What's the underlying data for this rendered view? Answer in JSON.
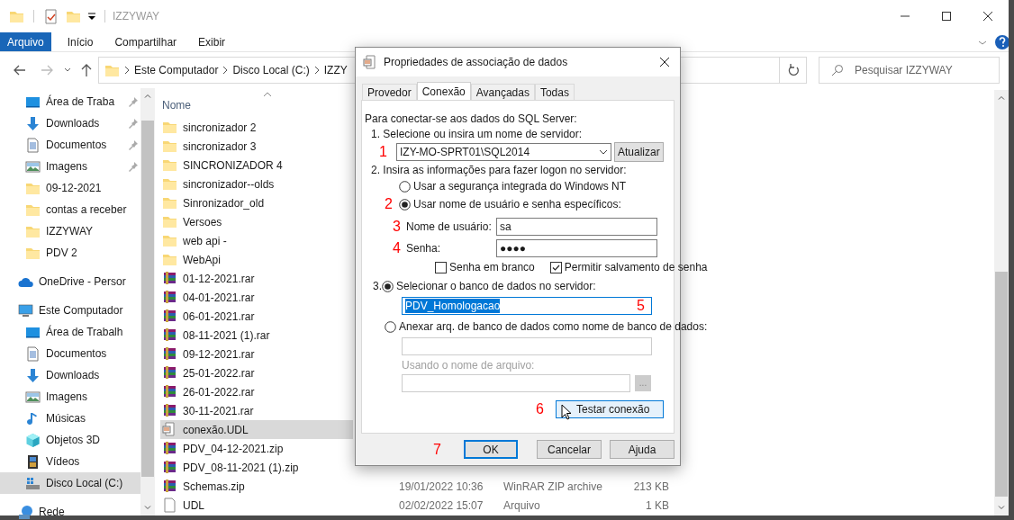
{
  "window": {
    "title": "IZZYWAY"
  },
  "ribbon_tabs": [
    {
      "label": "Arquivo",
      "selected": true
    },
    {
      "label": "Início",
      "selected": false
    },
    {
      "label": "Compartilhar",
      "selected": false
    },
    {
      "label": "Exibir",
      "selected": false
    }
  ],
  "address": {
    "breadcrumbs": [
      "Este Computador",
      "Disco Local (C:)",
      "IZZY"
    ]
  },
  "search": {
    "placeholder": "Pesquisar IZZYWAY"
  },
  "sidebar": {
    "quick_access": [
      {
        "label": "Área de Traba",
        "kind": "desktop",
        "pinned": true,
        "selected": false
      },
      {
        "label": "Downloads",
        "kind": "download",
        "pinned": true,
        "selected": false
      },
      {
        "label": "Documentos",
        "kind": "document",
        "pinned": true,
        "selected": false
      },
      {
        "label": "Imagens",
        "kind": "image",
        "pinned": true,
        "selected": false
      },
      {
        "label": "09-12-2021",
        "kind": "folder",
        "pinned": false,
        "selected": false
      },
      {
        "label": "contas a receber",
        "kind": "folder",
        "pinned": false,
        "selected": false
      },
      {
        "label": "IZZYWAY",
        "kind": "folder",
        "pinned": false,
        "selected": false
      },
      {
        "label": "PDV 2",
        "kind": "folder",
        "pinned": false,
        "selected": false
      }
    ],
    "tree": [
      {
        "label": "OneDrive - Persor",
        "kind": "cloud",
        "selected": false
      },
      {
        "label": "Este Computador",
        "kind": "computer",
        "selected": false,
        "children": [
          {
            "label": "Área de Trabalh",
            "kind": "desktop",
            "selected": false
          },
          {
            "label": "Documentos",
            "kind": "document",
            "selected": false
          },
          {
            "label": "Downloads",
            "kind": "download",
            "selected": false
          },
          {
            "label": "Imagens",
            "kind": "image",
            "selected": false
          },
          {
            "label": "Músicas",
            "kind": "music",
            "selected": false
          },
          {
            "label": "Objetos 3D",
            "kind": "cube",
            "selected": false
          },
          {
            "label": "Vídeos",
            "kind": "video",
            "selected": false
          },
          {
            "label": "Disco Local (C:)",
            "kind": "drive",
            "selected": true
          }
        ]
      },
      {
        "label": "Rede",
        "kind": "network",
        "selected": false
      }
    ]
  },
  "file_list": {
    "columns": [
      "Nome"
    ],
    "rows": [
      {
        "name": "sincronizador 2",
        "kind": "folder",
        "selected": false
      },
      {
        "name": "sincronizador 3",
        "kind": "folder",
        "selected": false
      },
      {
        "name": "SINCRONIZADOR 4",
        "kind": "folder",
        "selected": false
      },
      {
        "name": "sincronizador--olds",
        "kind": "folder",
        "selected": false
      },
      {
        "name": "Sinronizador_old",
        "kind": "folder",
        "selected": false
      },
      {
        "name": "Versoes",
        "kind": "folder",
        "selected": false
      },
      {
        "name": "web api -",
        "kind": "folder",
        "selected": false
      },
      {
        "name": "WebApi",
        "kind": "folder",
        "selected": false
      },
      {
        "name": "01-12-2021.rar",
        "kind": "archive",
        "selected": false
      },
      {
        "name": "04-01-2021.rar",
        "kind": "archive",
        "selected": false
      },
      {
        "name": "06-01-2021.rar",
        "kind": "archive",
        "selected": false
      },
      {
        "name": "08-11-2021 (1).rar",
        "kind": "archive",
        "selected": false
      },
      {
        "name": "09-12-2021.rar",
        "kind": "archive",
        "selected": false
      },
      {
        "name": "25-01-2022.rar",
        "kind": "archive",
        "selected": false
      },
      {
        "name": "26-01-2022.rar",
        "kind": "archive",
        "selected": false
      },
      {
        "name": "30-11-2021.rar",
        "kind": "archive",
        "selected": false
      },
      {
        "name": "conexão.UDL",
        "kind": "udl",
        "selected": true
      },
      {
        "name": "PDV_04-12-2021.zip",
        "kind": "archive",
        "selected": false
      },
      {
        "name": "PDV_08-11-2021 (1).zip",
        "kind": "archive",
        "selected": false
      },
      {
        "name": "Schemas.zip",
        "kind": "archive",
        "selected": false,
        "date": "19/01/2022 10:36",
        "type": "WinRAR ZIP archive",
        "size": "213 KB"
      },
      {
        "name": "UDL",
        "kind": "file",
        "selected": false,
        "date": "02/02/2022 15:07",
        "type": "Arquivo",
        "size": "1 KB"
      }
    ]
  },
  "dialog": {
    "title": "Propriedades de associação de dados",
    "tabs": [
      {
        "label": "Provedor",
        "selected": false
      },
      {
        "label": "Conexão",
        "selected": true
      },
      {
        "label": "Avançadas",
        "selected": false
      },
      {
        "label": "Todas",
        "selected": false
      }
    ],
    "intro": "Para conectar-se aos dados do SQL Server:",
    "step1": "1. Selecione ou insira um nome de servidor:",
    "server": {
      "value": "IZY-MO-SPRT01\\SQL2014",
      "marker": "1"
    },
    "refresh_button": "Atualizar",
    "step2": "2. Insira as informações para fazer logon no servidor:",
    "auth_options": [
      {
        "label": "Usar a segurança integrada do Windows NT",
        "selected": false
      },
      {
        "label": "Usar nome de usuário e senha específicos:",
        "selected": true,
        "marker": "2"
      }
    ],
    "username": {
      "label": "Nome de usuário:",
      "value": "sa",
      "marker": "3"
    },
    "password": {
      "label": "Senha:",
      "value": "●●●●",
      "marker": "4"
    },
    "checkboxes": [
      {
        "label": "Senha em branco",
        "checked": false
      },
      {
        "label": "Permitir salvamento de senha",
        "checked": true
      }
    ],
    "db_options": [
      {
        "prefix": "3.",
        "label": "Selecionar o banco de dados no servidor:",
        "selected": true
      },
      {
        "label": "Anexar arq. de banco de dados como nome de banco de dados:",
        "selected": false
      }
    ],
    "database": {
      "value": "PDV_Homologacao",
      "marker": "5"
    },
    "filename_label": "Usando o nome de arquivo:",
    "browse_button": "...",
    "test_button": {
      "label": "Testar conexão",
      "marker": "6"
    },
    "buttons": [
      {
        "label": "OK",
        "default": true,
        "marker": "7"
      },
      {
        "label": "Cancelar",
        "default": false
      },
      {
        "label": "Ajuda",
        "default": false
      }
    ]
  }
}
